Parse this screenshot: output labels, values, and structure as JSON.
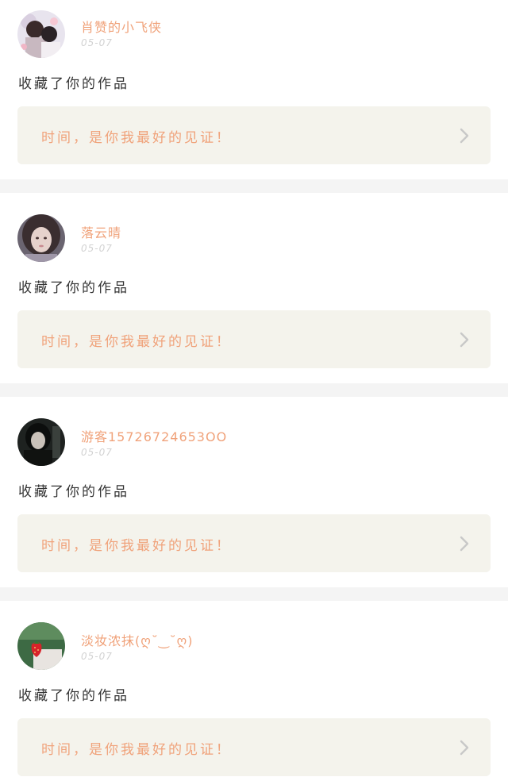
{
  "feed": {
    "items": [
      {
        "username": "肖赞的小飞侠",
        "date": "05-07",
        "action": "收藏了你的作品",
        "work_title": "时间，是你我最好的见证！",
        "avatar_icon": "avatar-photo-couple"
      },
      {
        "username": "落云晴",
        "date": "05-07",
        "action": "收藏了你的作品",
        "work_title": "时间，是你我最好的见证！",
        "avatar_icon": "avatar-photo-girl"
      },
      {
        "username": "游客15726724653OO",
        "date": "05-07",
        "action": "收藏了你的作品",
        "work_title": "时间，是你我最好的见证！",
        "avatar_icon": "avatar-photo-dark"
      },
      {
        "username": "淡妆浓抹(ღ˘‿˘ღ)",
        "date": "05-07",
        "action": "收藏了你的作品",
        "work_title": "时间，是你我最好的见证！",
        "avatar_icon": "avatar-photo-strawberry"
      }
    ]
  },
  "colors": {
    "accent": "#f0a27a",
    "card_bg": "#ffffff",
    "separator_bg": "#f4f4f4",
    "work_box_bg": "#f4f3ec",
    "date_text": "#d2d2d2",
    "body_text": "#333333",
    "chevron": "#c8c8c8"
  }
}
